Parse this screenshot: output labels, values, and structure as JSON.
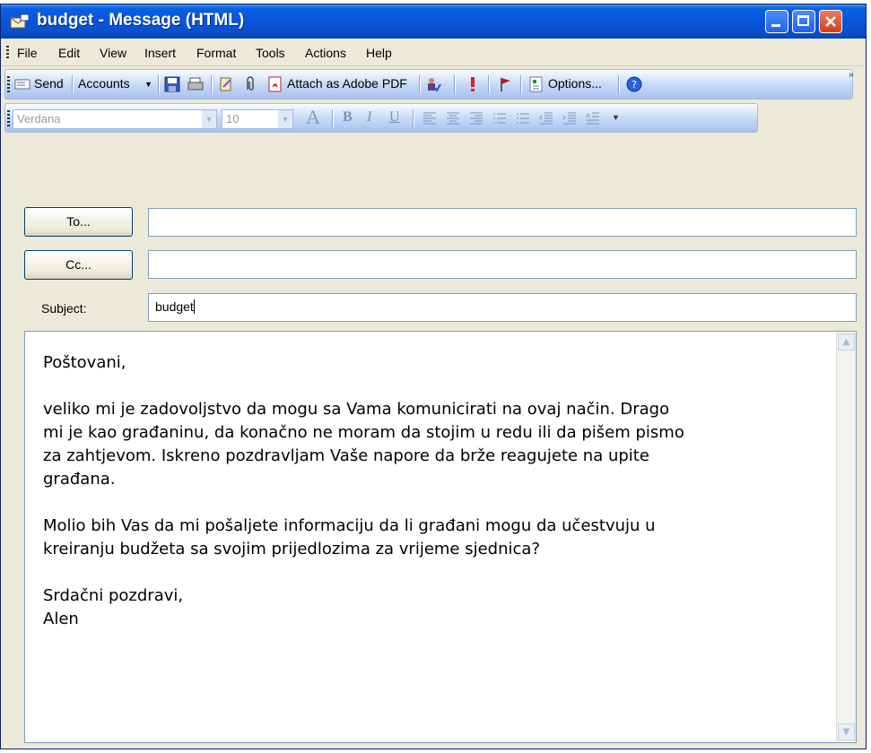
{
  "window": {
    "title": "budget - Message (HTML)"
  },
  "menu": [
    "File",
    "Edit",
    "View",
    "Insert",
    "Format",
    "Tools",
    "Actions",
    "Help"
  ],
  "toolbar": {
    "send": "Send",
    "accounts": "Accounts",
    "attach_pdf": "Attach as Adobe PDF",
    "options": "Options..."
  },
  "format_toolbar": {
    "font": "Verdana",
    "size": "10"
  },
  "fields": {
    "to_button": "To...",
    "cc_button": "Cc...",
    "subject_label": "Subject:",
    "to_value": "",
    "cc_value": "",
    "subject_value": "budget"
  },
  "body": {
    "paragraphs": [
      "Poštovani,",
      "veliko mi je zadovoljstvo da mogu sa Vama komunicirati na ovaj način. Drago\nmi je kao građaninu, da konačno ne moram da stojim u redu ili da pišem pismo\nza zahtjevom. Iskreno pozdravljam Vaše napore da brže reagujete na upite\ngrađana.",
      "Molio bih Vas da mi pošaljete informaciju da li građani mogu da učestvuju u\nkreiranju budžeta sa svojim prijedlozima za vrijeme sjednica?",
      "Srdačni pozdravi,\nAlen"
    ]
  },
  "colors": {
    "title_bar": "#0855dd",
    "close_button": "#d33e16",
    "toolbar": "#c4d7f6",
    "window_bg": "#ece9d8"
  }
}
